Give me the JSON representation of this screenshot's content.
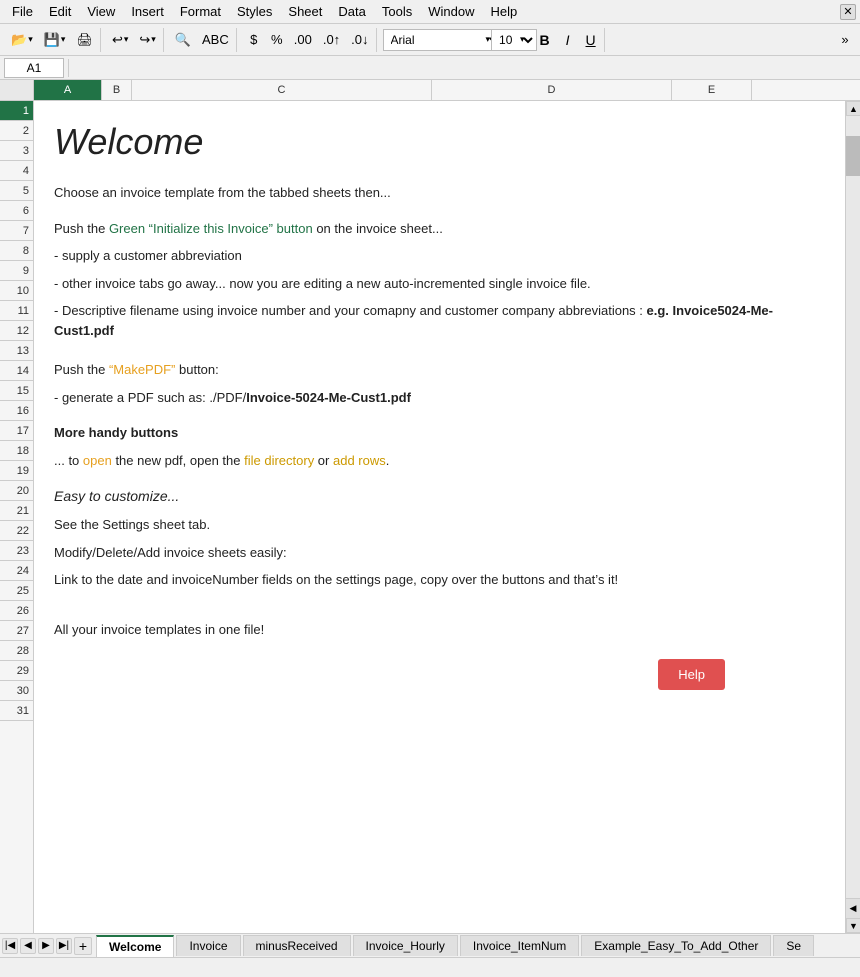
{
  "menu": {
    "items": [
      "File",
      "Edit",
      "View",
      "Insert",
      "Format",
      "Styles",
      "Sheet",
      "Data",
      "Tools",
      "Window",
      "Help"
    ]
  },
  "toolbar": {
    "font": "Arial",
    "font_size": "10",
    "bold": "B",
    "italic": "I",
    "underline": "U"
  },
  "name_box": {
    "value": "A1"
  },
  "content": {
    "welcome_heading": "Welcome",
    "intro_text": "Choose an invoice template from the tabbed sheets then...",
    "section1_label": "Push the ",
    "section1_green": "Green “Initialize this Invoice” button",
    "section1_after": " on the invoice sheet...",
    "bullet1": "- supply a customer abbreviation",
    "bullet2": "- other invoice tabs go away... now you are editing a new auto-incremented single invoice file.",
    "bullet3_before": "- Descriptive filename using invoice number and your comapny and customer company abbreviations :  ",
    "bullet3_bold": "e.g. Invoice5024-Me-Cust1.pdf",
    "section2_label": "Push the ",
    "section2_orange": "“MakePDF”",
    "section2_after": " button:",
    "bullet4_before": "- generate a PDF such as:   ./PDF/",
    "bullet4_bold": "Invoice-5024-Me-Cust1.pdf",
    "handy_heading": "More handy buttons",
    "handy_text_before": "...  to ",
    "handy_open": "open",
    "handy_text_mid": " the new pdf,  open the ",
    "handy_file_dir": "file directory",
    "handy_text_or": " or ",
    "handy_add_rows": "add rows",
    "handy_end": ".",
    "easy_heading": "Easy to customize...",
    "see_settings": "See the Settings sheet tab.",
    "modify_text": "Modify/Delete/Add invoice sheets easily:",
    "link_text": "Link to the date and invoiceNumber fields on the settings page, copy over the buttons and that’s it!",
    "all_templates": "All your invoice templates in one file!",
    "help_button": "Help"
  },
  "row_headers": [
    "1",
    "2",
    "3",
    "4",
    "5",
    "6",
    "7",
    "8",
    "9",
    "10",
    "11",
    "12",
    "13",
    "14",
    "15",
    "16",
    "17",
    "18",
    "19",
    "20",
    "21",
    "22",
    "23",
    "24",
    "25",
    "26",
    "27",
    "28",
    "29",
    "30",
    "31"
  ],
  "col_headers": [
    "A",
    "B",
    "C",
    "D",
    "E"
  ],
  "sheets": {
    "tabs": [
      "Welcome",
      "Invoice",
      "minusReceived",
      "Invoice_Hourly",
      "Invoice_ItemNum",
      "Example_Easy_To_Add_Other",
      "Se"
    ],
    "active": "Welcome"
  },
  "status": ""
}
